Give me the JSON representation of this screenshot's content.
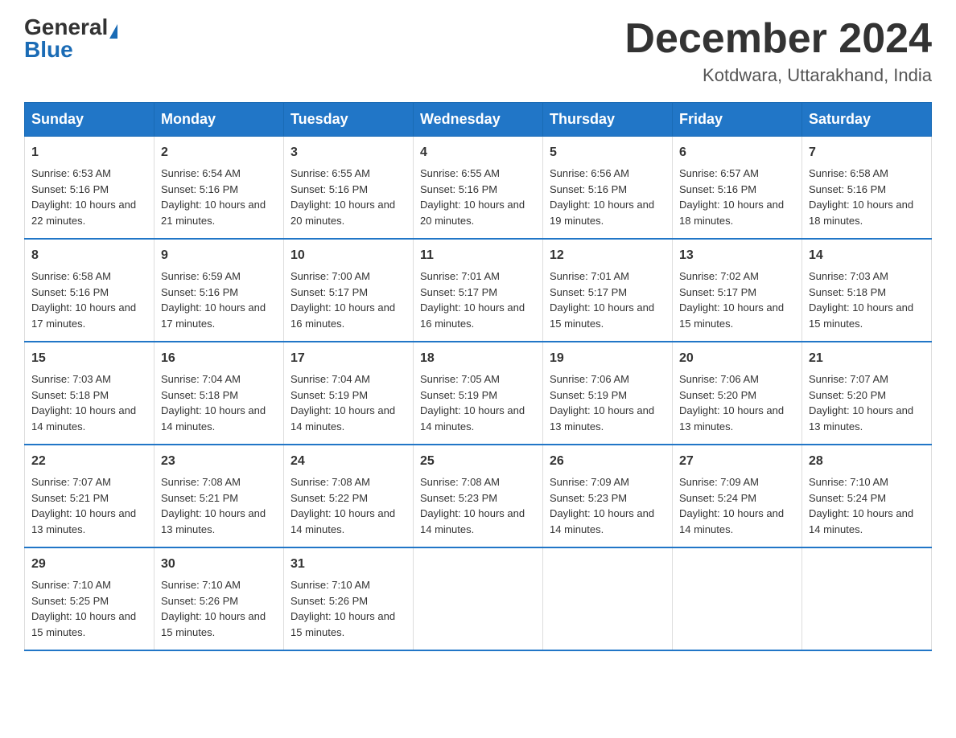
{
  "logo": {
    "general": "General",
    "blue": "Blue"
  },
  "header": {
    "month": "December 2024",
    "location": "Kotdwara, Uttarakhand, India"
  },
  "days_of_week": [
    "Sunday",
    "Monday",
    "Tuesday",
    "Wednesday",
    "Thursday",
    "Friday",
    "Saturday"
  ],
  "weeks": [
    [
      {
        "day": "1",
        "sunrise": "6:53 AM",
        "sunset": "5:16 PM",
        "daylight": "10 hours and 22 minutes."
      },
      {
        "day": "2",
        "sunrise": "6:54 AM",
        "sunset": "5:16 PM",
        "daylight": "10 hours and 21 minutes."
      },
      {
        "day": "3",
        "sunrise": "6:55 AM",
        "sunset": "5:16 PM",
        "daylight": "10 hours and 20 minutes."
      },
      {
        "day": "4",
        "sunrise": "6:55 AM",
        "sunset": "5:16 PM",
        "daylight": "10 hours and 20 minutes."
      },
      {
        "day": "5",
        "sunrise": "6:56 AM",
        "sunset": "5:16 PM",
        "daylight": "10 hours and 19 minutes."
      },
      {
        "day": "6",
        "sunrise": "6:57 AM",
        "sunset": "5:16 PM",
        "daylight": "10 hours and 18 minutes."
      },
      {
        "day": "7",
        "sunrise": "6:58 AM",
        "sunset": "5:16 PM",
        "daylight": "10 hours and 18 minutes."
      }
    ],
    [
      {
        "day": "8",
        "sunrise": "6:58 AM",
        "sunset": "5:16 PM",
        "daylight": "10 hours and 17 minutes."
      },
      {
        "day": "9",
        "sunrise": "6:59 AM",
        "sunset": "5:16 PM",
        "daylight": "10 hours and 17 minutes."
      },
      {
        "day": "10",
        "sunrise": "7:00 AM",
        "sunset": "5:17 PM",
        "daylight": "10 hours and 16 minutes."
      },
      {
        "day": "11",
        "sunrise": "7:01 AM",
        "sunset": "5:17 PM",
        "daylight": "10 hours and 16 minutes."
      },
      {
        "day": "12",
        "sunrise": "7:01 AM",
        "sunset": "5:17 PM",
        "daylight": "10 hours and 15 minutes."
      },
      {
        "day": "13",
        "sunrise": "7:02 AM",
        "sunset": "5:17 PM",
        "daylight": "10 hours and 15 minutes."
      },
      {
        "day": "14",
        "sunrise": "7:03 AM",
        "sunset": "5:18 PM",
        "daylight": "10 hours and 15 minutes."
      }
    ],
    [
      {
        "day": "15",
        "sunrise": "7:03 AM",
        "sunset": "5:18 PM",
        "daylight": "10 hours and 14 minutes."
      },
      {
        "day": "16",
        "sunrise": "7:04 AM",
        "sunset": "5:18 PM",
        "daylight": "10 hours and 14 minutes."
      },
      {
        "day": "17",
        "sunrise": "7:04 AM",
        "sunset": "5:19 PM",
        "daylight": "10 hours and 14 minutes."
      },
      {
        "day": "18",
        "sunrise": "7:05 AM",
        "sunset": "5:19 PM",
        "daylight": "10 hours and 14 minutes."
      },
      {
        "day": "19",
        "sunrise": "7:06 AM",
        "sunset": "5:19 PM",
        "daylight": "10 hours and 13 minutes."
      },
      {
        "day": "20",
        "sunrise": "7:06 AM",
        "sunset": "5:20 PM",
        "daylight": "10 hours and 13 minutes."
      },
      {
        "day": "21",
        "sunrise": "7:07 AM",
        "sunset": "5:20 PM",
        "daylight": "10 hours and 13 minutes."
      }
    ],
    [
      {
        "day": "22",
        "sunrise": "7:07 AM",
        "sunset": "5:21 PM",
        "daylight": "10 hours and 13 minutes."
      },
      {
        "day": "23",
        "sunrise": "7:08 AM",
        "sunset": "5:21 PM",
        "daylight": "10 hours and 13 minutes."
      },
      {
        "day": "24",
        "sunrise": "7:08 AM",
        "sunset": "5:22 PM",
        "daylight": "10 hours and 14 minutes."
      },
      {
        "day": "25",
        "sunrise": "7:08 AM",
        "sunset": "5:23 PM",
        "daylight": "10 hours and 14 minutes."
      },
      {
        "day": "26",
        "sunrise": "7:09 AM",
        "sunset": "5:23 PM",
        "daylight": "10 hours and 14 minutes."
      },
      {
        "day": "27",
        "sunrise": "7:09 AM",
        "sunset": "5:24 PM",
        "daylight": "10 hours and 14 minutes."
      },
      {
        "day": "28",
        "sunrise": "7:10 AM",
        "sunset": "5:24 PM",
        "daylight": "10 hours and 14 minutes."
      }
    ],
    [
      {
        "day": "29",
        "sunrise": "7:10 AM",
        "sunset": "5:25 PM",
        "daylight": "10 hours and 15 minutes."
      },
      {
        "day": "30",
        "sunrise": "7:10 AM",
        "sunset": "5:26 PM",
        "daylight": "10 hours and 15 minutes."
      },
      {
        "day": "31",
        "sunrise": "7:10 AM",
        "sunset": "5:26 PM",
        "daylight": "10 hours and 15 minutes."
      },
      null,
      null,
      null,
      null
    ]
  ]
}
